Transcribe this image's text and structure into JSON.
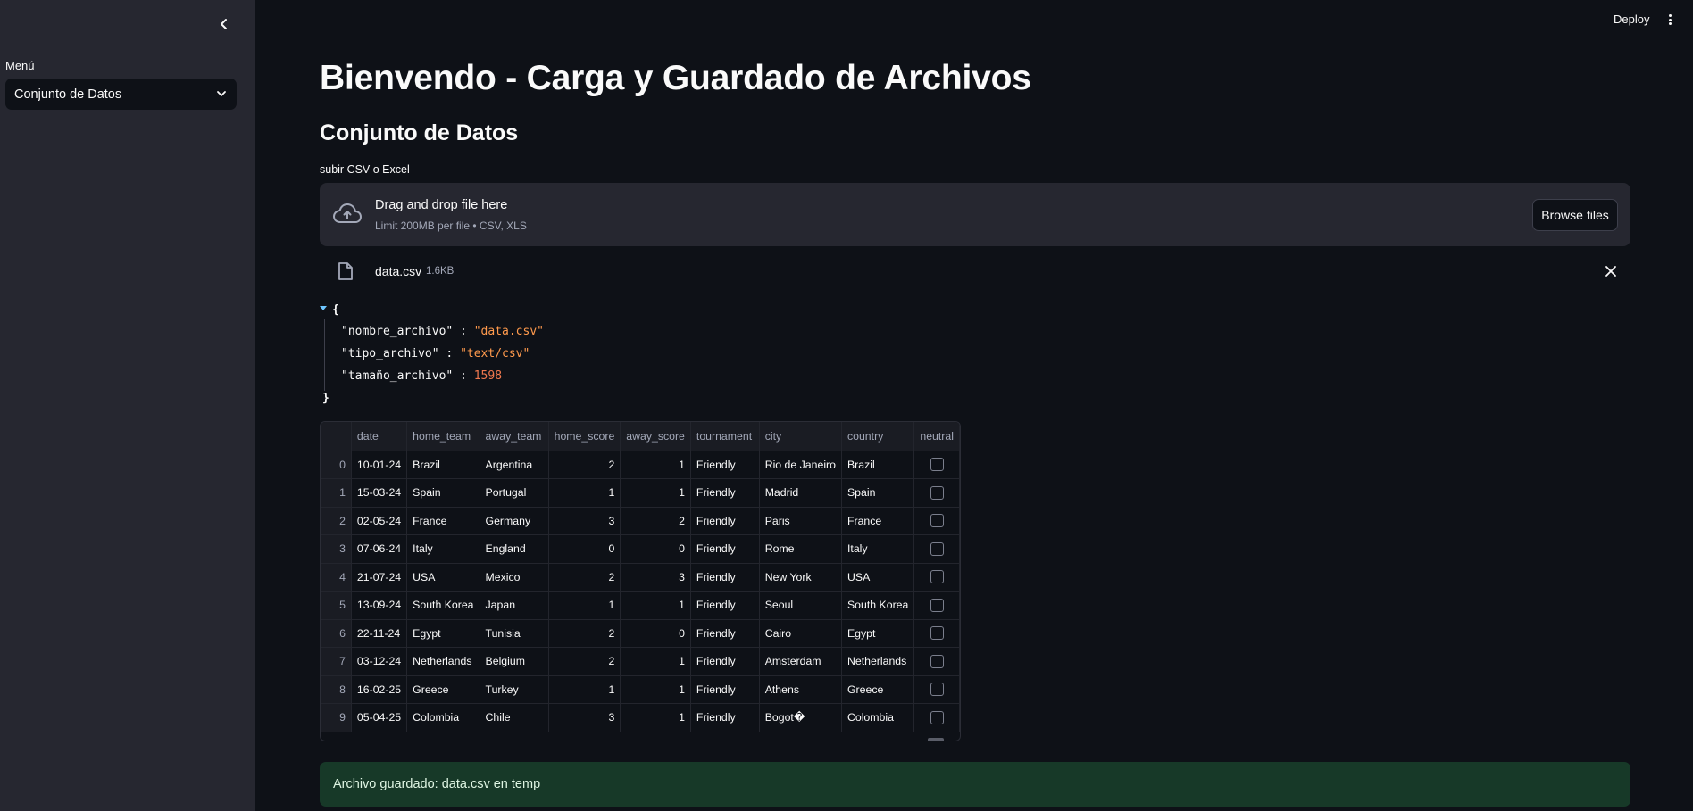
{
  "sidebar": {
    "menu_label": "Menú",
    "select_value": "Conjunto de Datos",
    "collapse_icon": "chevron-left-icon"
  },
  "header": {
    "deploy_label": "Deploy",
    "menu_icon": "kebab-menu-icon"
  },
  "main": {
    "title": "Bienvendo - Carga y Guardado de Archivos",
    "subtitle": "Conjunto de Datos",
    "uploader": {
      "label": "subir CSV o Excel",
      "dropzone_title": "Drag and drop file here",
      "dropzone_limit": "Limit 200MB per file • CSV, XLS",
      "browse_label": "Browse files",
      "icon": "cloud-upload-icon"
    },
    "uploaded_file": {
      "name": "data.csv",
      "size": "1.6KB",
      "icon": "file-icon"
    },
    "json_view": {
      "open": "{",
      "close": "}",
      "entries": [
        {
          "key": "\"nombre_archivo\"",
          "value": "\"data.csv\""
        },
        {
          "key": "\"tipo_archivo\"",
          "value": "\"text/csv\""
        },
        {
          "key": "\"tamaño_archivo\"",
          "value": "1598"
        }
      ]
    },
    "table": {
      "columns": [
        "date",
        "home_team",
        "away_team",
        "home_score",
        "away_score",
        "tournament",
        "city",
        "country",
        "neutral"
      ],
      "rows": [
        {
          "idx": "0",
          "date": "10-01-24",
          "home_team": "Brazil",
          "away_team": "Argentina",
          "home_score": "2",
          "away_score": "1",
          "tournament": "Friendly",
          "city": "Rio de Janeiro",
          "country": "Brazil"
        },
        {
          "idx": "1",
          "date": "15-03-24",
          "home_team": "Spain",
          "away_team": "Portugal",
          "home_score": "1",
          "away_score": "1",
          "tournament": "Friendly",
          "city": "Madrid",
          "country": "Spain"
        },
        {
          "idx": "2",
          "date": "02-05-24",
          "home_team": "France",
          "away_team": "Germany",
          "home_score": "3",
          "away_score": "2",
          "tournament": "Friendly",
          "city": "Paris",
          "country": "France"
        },
        {
          "idx": "3",
          "date": "07-06-24",
          "home_team": "Italy",
          "away_team": "England",
          "home_score": "0",
          "away_score": "0",
          "tournament": "Friendly",
          "city": "Rome",
          "country": "Italy"
        },
        {
          "idx": "4",
          "date": "21-07-24",
          "home_team": "USA",
          "away_team": "Mexico",
          "home_score": "2",
          "away_score": "3",
          "tournament": "Friendly",
          "city": "New York",
          "country": "USA"
        },
        {
          "idx": "5",
          "date": "13-09-24",
          "home_team": "South Korea",
          "away_team": "Japan",
          "home_score": "1",
          "away_score": "1",
          "tournament": "Friendly",
          "city": "Seoul",
          "country": "South Korea"
        },
        {
          "idx": "6",
          "date": "22-11-24",
          "home_team": "Egypt",
          "away_team": "Tunisia",
          "home_score": "2",
          "away_score": "0",
          "tournament": "Friendly",
          "city": "Cairo",
          "country": "Egypt"
        },
        {
          "idx": "7",
          "date": "03-12-24",
          "home_team": "Netherlands",
          "away_team": "Belgium",
          "home_score": "2",
          "away_score": "1",
          "tournament": "Friendly",
          "city": "Amsterdam",
          "country": "Netherlands"
        },
        {
          "idx": "8",
          "date": "16-02-25",
          "home_team": "Greece",
          "away_team": "Turkey",
          "home_score": "1",
          "away_score": "1",
          "tournament": "Friendly",
          "city": "Athens",
          "country": "Greece"
        },
        {
          "idx": "9",
          "date": "05-04-25",
          "home_team": "Colombia",
          "away_team": "Chile",
          "home_score": "3",
          "away_score": "1",
          "tournament": "Friendly",
          "city": "Bogot�",
          "country": "Colombia"
        }
      ]
    },
    "success_message": "Archivo guardado: data.csv en temp"
  },
  "colors": {
    "background": "#0e1117",
    "sidebar": "#262730",
    "json_string": "#ff9a4d",
    "success_bg": "#173928"
  }
}
